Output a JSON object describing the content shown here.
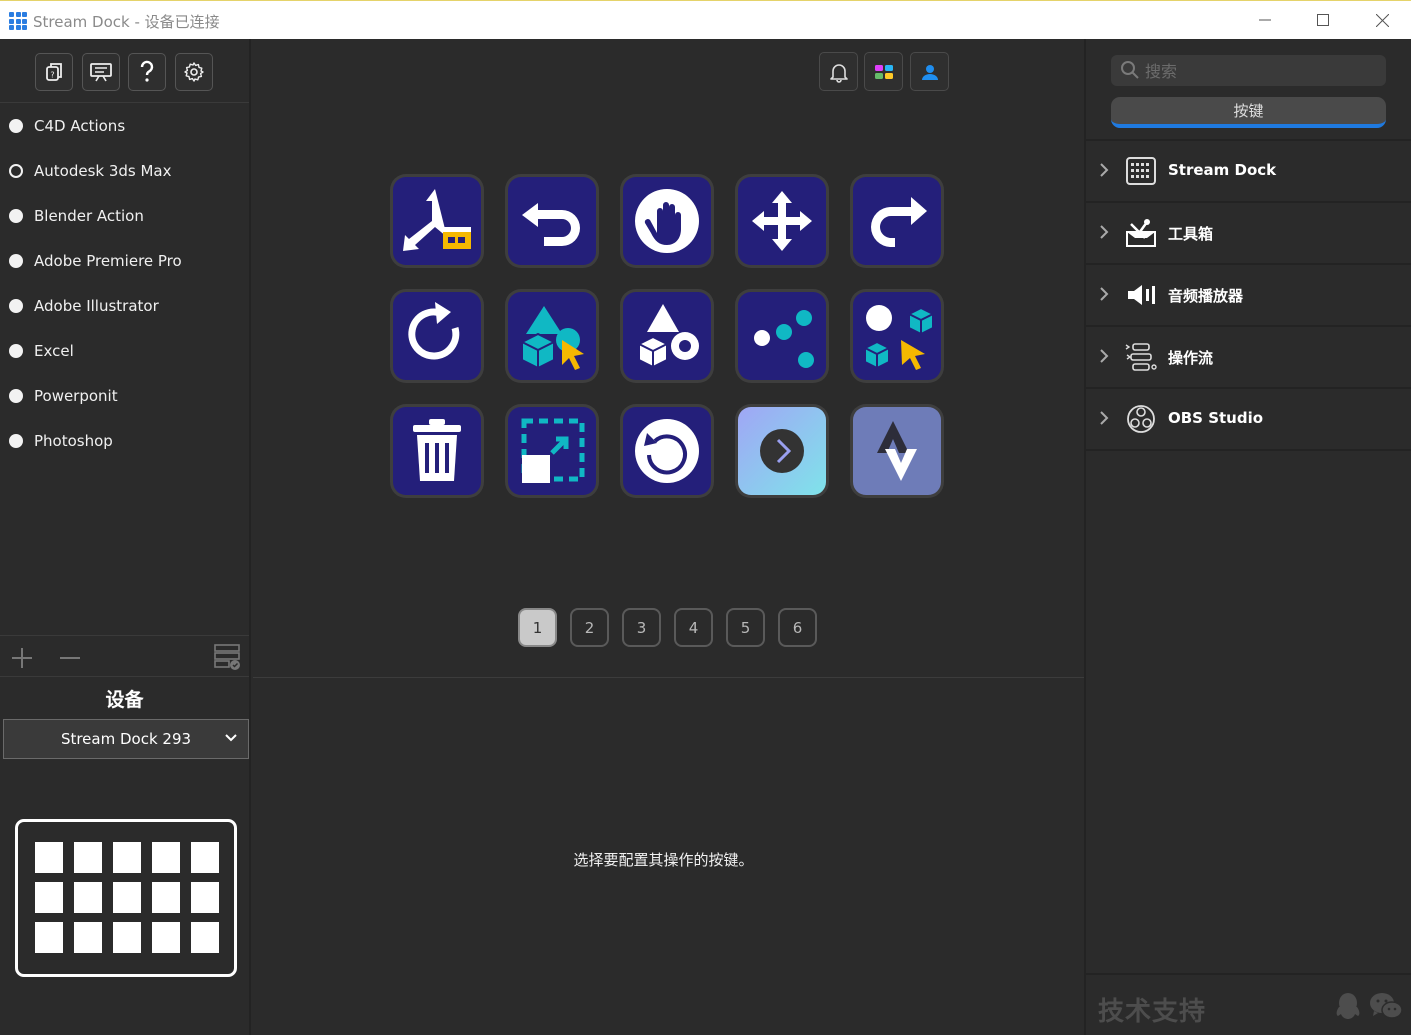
{
  "window": {
    "title": "Stream Dock - 设备已连接"
  },
  "left": {
    "profiles": [
      {
        "label": "C4D Actions",
        "selected": false
      },
      {
        "label": "Autodesk 3ds Max",
        "selected": true
      },
      {
        "label": "Blender  Action",
        "selected": false
      },
      {
        "label": "Adobe Premiere Pro",
        "selected": false
      },
      {
        "label": "Adobe Illustrator",
        "selected": false
      },
      {
        "label": "Excel",
        "selected": false
      },
      {
        "label": "Powerponit",
        "selected": false
      },
      {
        "label": "Photoshop",
        "selected": false
      }
    ],
    "device_title": "设备",
    "device_select": "Stream Dock 293"
  },
  "center": {
    "keys": [
      "axis-gizmo-icon",
      "undo-icon",
      "hand-pan-icon",
      "move-arrows-icon",
      "redo-icon",
      "rotate-cw-icon",
      "select-object-icon",
      "primitives-icon",
      "particles-icon",
      "shapes-select-icon",
      "trash-icon",
      "scale-select-icon",
      "rotate-view-icon",
      "next-page-icon",
      "toggle-arrows-icon"
    ],
    "pages": [
      "1",
      "2",
      "3",
      "4",
      "5",
      "6"
    ],
    "active_page": "1",
    "hint": "选择要配置其操作的按键。"
  },
  "right": {
    "search_placeholder": "搜索",
    "tab_label": "按键",
    "categories": [
      {
        "label": "Stream Dock",
        "icon": "keypad-icon"
      },
      {
        "label": "工具箱",
        "icon": "toolbox-icon"
      },
      {
        "label": "音频播放器",
        "icon": "speaker-icon"
      },
      {
        "label": "操作流",
        "icon": "flow-icon"
      },
      {
        "label": "OBS Studio",
        "icon": "obs-icon"
      }
    ],
    "support_label": "技术支持"
  },
  "colors": {
    "key_face": "#241f7a",
    "accent_blue": "#1f7ae0",
    "teal": "#10b8c4",
    "yellow": "#f5b800"
  }
}
